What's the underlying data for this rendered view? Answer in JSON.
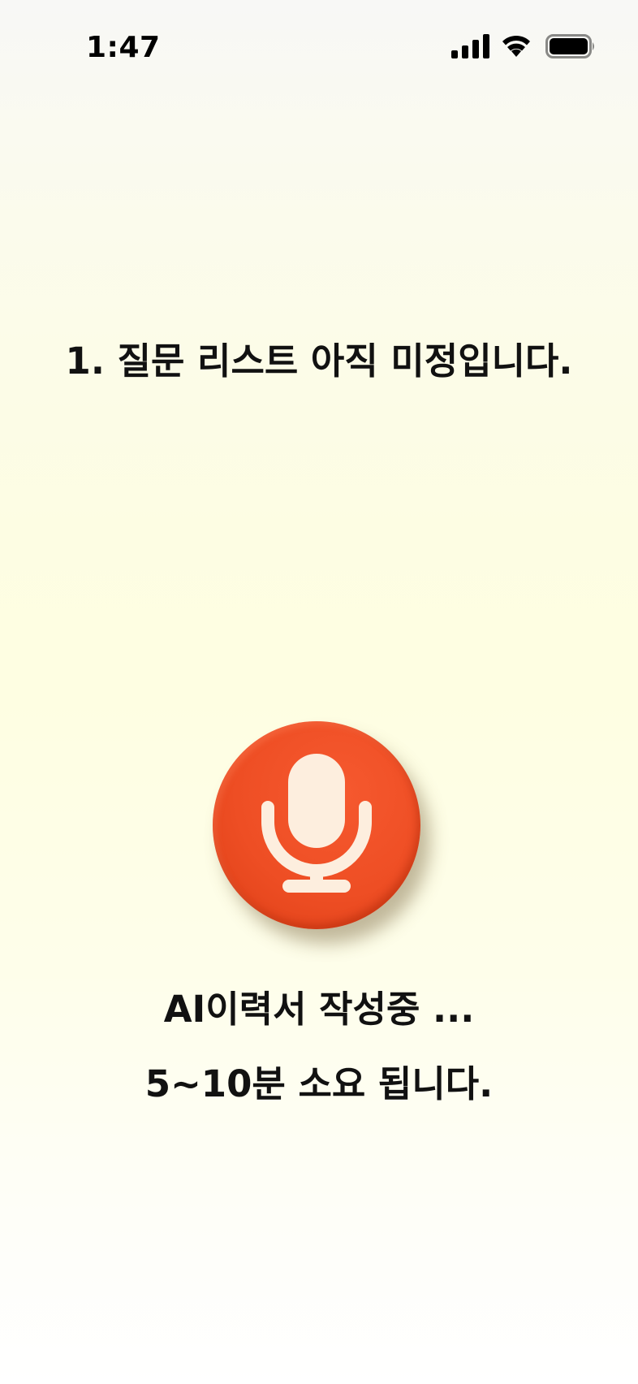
{
  "status_bar": {
    "time": "1:47",
    "icons": [
      "signal-icon",
      "wifi-icon",
      "battery-icon"
    ]
  },
  "question": {
    "title": "1.  질문 리스트 아직 미정입니다."
  },
  "mic": {
    "icon": "microphone-icon",
    "color": "#EE4E24"
  },
  "status": {
    "line1": "AI이력서 작성중 ...",
    "line2": "5~10분 소요 됩니다."
  }
}
